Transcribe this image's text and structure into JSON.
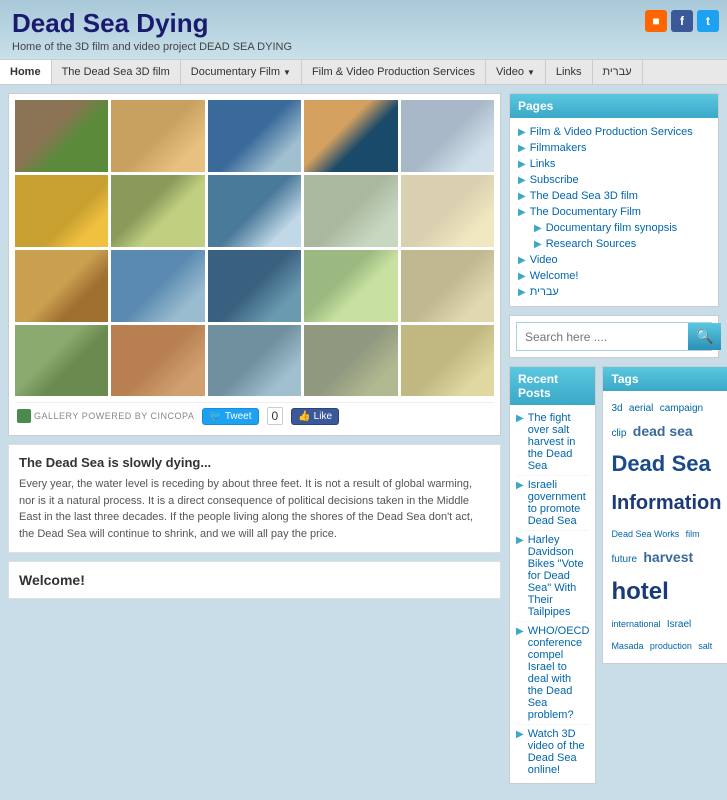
{
  "site": {
    "title": "Dead Sea Dying",
    "tagline": "Home of the 3D film and video project DEAD SEA DYING"
  },
  "nav": {
    "items": [
      {
        "id": "home",
        "label": "Home",
        "active": true,
        "dropdown": false
      },
      {
        "id": "dead-sea-3d",
        "label": "The Dead Sea 3D film",
        "active": false,
        "dropdown": false
      },
      {
        "id": "documentary",
        "label": "Documentary Film",
        "active": false,
        "dropdown": true
      },
      {
        "id": "film-video",
        "label": "Film & Video Production Services",
        "active": false,
        "dropdown": false
      },
      {
        "id": "video",
        "label": "Video",
        "active": false,
        "dropdown": true
      },
      {
        "id": "links",
        "label": "Links",
        "active": false,
        "dropdown": false
      },
      {
        "id": "hebrew",
        "label": "עברית",
        "active": false,
        "dropdown": false
      }
    ]
  },
  "gallery": {
    "powered_text": "Gallery Powered by Cincopa",
    "tweet_label": "Tweet",
    "tweet_count": "0",
    "like_label": "Like"
  },
  "article": {
    "heading": "The Dead Sea is slowly dying...",
    "body": "Every year, the water level is receding by about three feet. It is not a result of global warming, nor is it a natural process. It is a direct consequence of political decisions taken in the Middle East in the last three decades. If the people living along the shores of the Dead Sea don't act, the Dead Sea will continue to shrink, and we will all pay the price."
  },
  "welcome": {
    "heading": "Welcome!"
  },
  "sidebar": {
    "pages": {
      "header": "Pages",
      "items": [
        {
          "label": "Film & Video Production Services",
          "sub": false
        },
        {
          "label": "Filmmakers",
          "sub": false
        },
        {
          "label": "Links",
          "sub": false
        },
        {
          "label": "Subscribe",
          "sub": false
        },
        {
          "label": "The Dead Sea 3D film",
          "sub": false
        },
        {
          "label": "The Documentary Film",
          "sub": false
        },
        {
          "label": "Documentary film synopsis",
          "sub": true
        },
        {
          "label": "Research Sources",
          "sub": true
        },
        {
          "label": "Video",
          "sub": false
        },
        {
          "label": "Welcome!",
          "sub": false
        },
        {
          "label": "עברית",
          "sub": false
        }
      ]
    },
    "search": {
      "placeholder": "Search here ...."
    },
    "recent_posts": {
      "header": "Recent Posts",
      "items": [
        {
          "label": "The fight over salt harvest in the Dead Sea"
        },
        {
          "label": "Israeli government to promote Dead Sea"
        },
        {
          "label": "Harley Davidson Bikes \"Vote for Dead Sea\" With Their Tailpipes"
        },
        {
          "label": "WHO/OECD conference compel Israel to deal with the Dead Sea problem?"
        },
        {
          "label": "Watch 3D video of the Dead Sea online!"
        }
      ]
    },
    "tags": {
      "header": "Tags",
      "items": [
        {
          "label": "3d",
          "size": "small"
        },
        {
          "label": "aerial",
          "size": "small"
        },
        {
          "label": "campaign",
          "size": "small"
        },
        {
          "label": "clip",
          "size": "small"
        },
        {
          "label": "dead sea",
          "size": "medium"
        },
        {
          "label": "Dead",
          "size": "large"
        },
        {
          "label": "Sea",
          "size": "large"
        },
        {
          "label": "Information",
          "size": "xlarge"
        },
        {
          "label": "Dead Sea Works",
          "size": "small"
        },
        {
          "label": "film",
          "size": "small"
        },
        {
          "label": "future",
          "size": "small"
        },
        {
          "label": "harvest",
          "size": "medium"
        },
        {
          "label": "hotel",
          "size": "xlarge"
        },
        {
          "label": "international",
          "size": "small"
        },
        {
          "label": "Israel",
          "size": "small"
        },
        {
          "label": "Masada",
          "size": "small"
        },
        {
          "label": "production",
          "size": "small"
        },
        {
          "label": "salt",
          "size": "small"
        }
      ]
    }
  },
  "social": {
    "rss_label": "RSS",
    "facebook_label": "f",
    "twitter_label": "t"
  }
}
